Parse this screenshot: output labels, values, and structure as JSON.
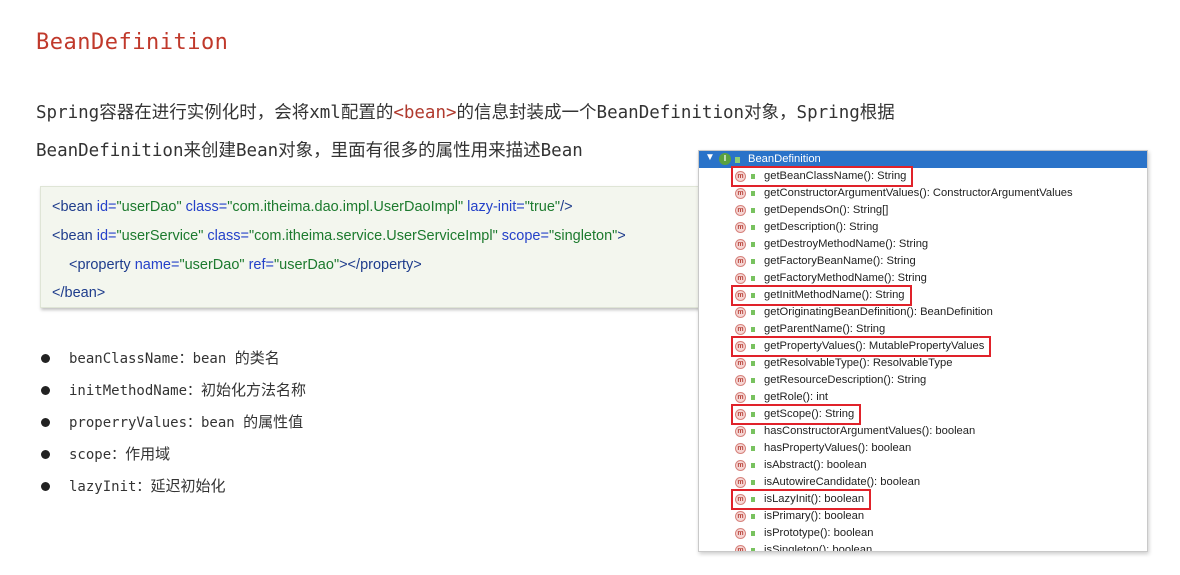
{
  "title": "BeanDefinition",
  "intro": {
    "line1_prefix": "Spring容器在进行实例化时，会将xml配置的",
    "line1_tag": "<bean>",
    "line1_suffix": "的信息封装成一个BeanDefinition对象，Spring根据",
    "line2": "BeanDefinition来创建Bean对象，里面有很多的属性用来描述Bean"
  },
  "code": {
    "l1": {
      "open": "<",
      "tag": "bean",
      "a1": " id=",
      "v1": "\"userDao\"",
      "a2": " class=",
      "v2": "\"com.itheima.dao.impl.UserDaoImpl\"",
      "a3": " lazy-init=",
      "v3": "\"true\"",
      "close": "/>"
    },
    "l2": {
      "open": "<",
      "tag": "bean",
      "a1": " id=",
      "v1": "\"userService\"",
      "a2": " class=",
      "v2": "\"com.itheima.service.UserServiceImpl\"",
      "a3": " scope=",
      "v3": "\"singleton\"",
      "close": ">"
    },
    "l3": {
      "open": "<",
      "tag": "property",
      "a1": " name=",
      "v1": "\"userDao\"",
      "a2": " ref=",
      "v2": "\"userDao\"",
      "mid": "></",
      "tag2": "property",
      "close": ">"
    },
    "l4": {
      "open": "</",
      "tag": "bean",
      "close": ">"
    }
  },
  "bullets": [
    {
      "key": "beanClassName：bean ",
      "cn": "的类名"
    },
    {
      "key": "initMethodName：",
      "cn": "初始化方法名称"
    },
    {
      "key": "properryValues：bean ",
      "cn": "的属性值"
    },
    {
      "key": "scope：",
      "cn": "作用域"
    },
    {
      "key": "lazyInit：",
      "cn": "延迟初始化"
    }
  ],
  "panel": {
    "header": "BeanDefinition",
    "header_icon": "I",
    "method_icon": "m",
    "methods": [
      "getBeanClassName(): String",
      "getConstructorArgumentValues(): ConstructorArgumentValues",
      "getDependsOn(): String[]",
      "getDescription(): String",
      "getDestroyMethodName(): String",
      "getFactoryBeanName(): String",
      "getFactoryMethodName(): String",
      "getInitMethodName(): String",
      "getOriginatingBeanDefinition(): BeanDefinition",
      "getParentName(): String",
      "getPropertyValues(): MutablePropertyValues",
      "getResolvableType(): ResolvableType",
      "getResourceDescription(): String",
      "getRole(): int",
      "getScope(): String",
      "hasConstructorArgumentValues(): boolean",
      "hasPropertyValues(): boolean",
      "isAbstract(): boolean",
      "isAutowireCandidate(): boolean",
      "isLazyInit(): boolean",
      "isPrimary(): boolean",
      "isPrototype(): boolean",
      "isSingleton(): boolean"
    ],
    "highlighted": [
      0,
      7,
      10,
      14,
      19
    ]
  },
  "colors": {
    "title": "#c0392b",
    "highlight": "#e0222a",
    "panel_header": "#2a73c9"
  }
}
